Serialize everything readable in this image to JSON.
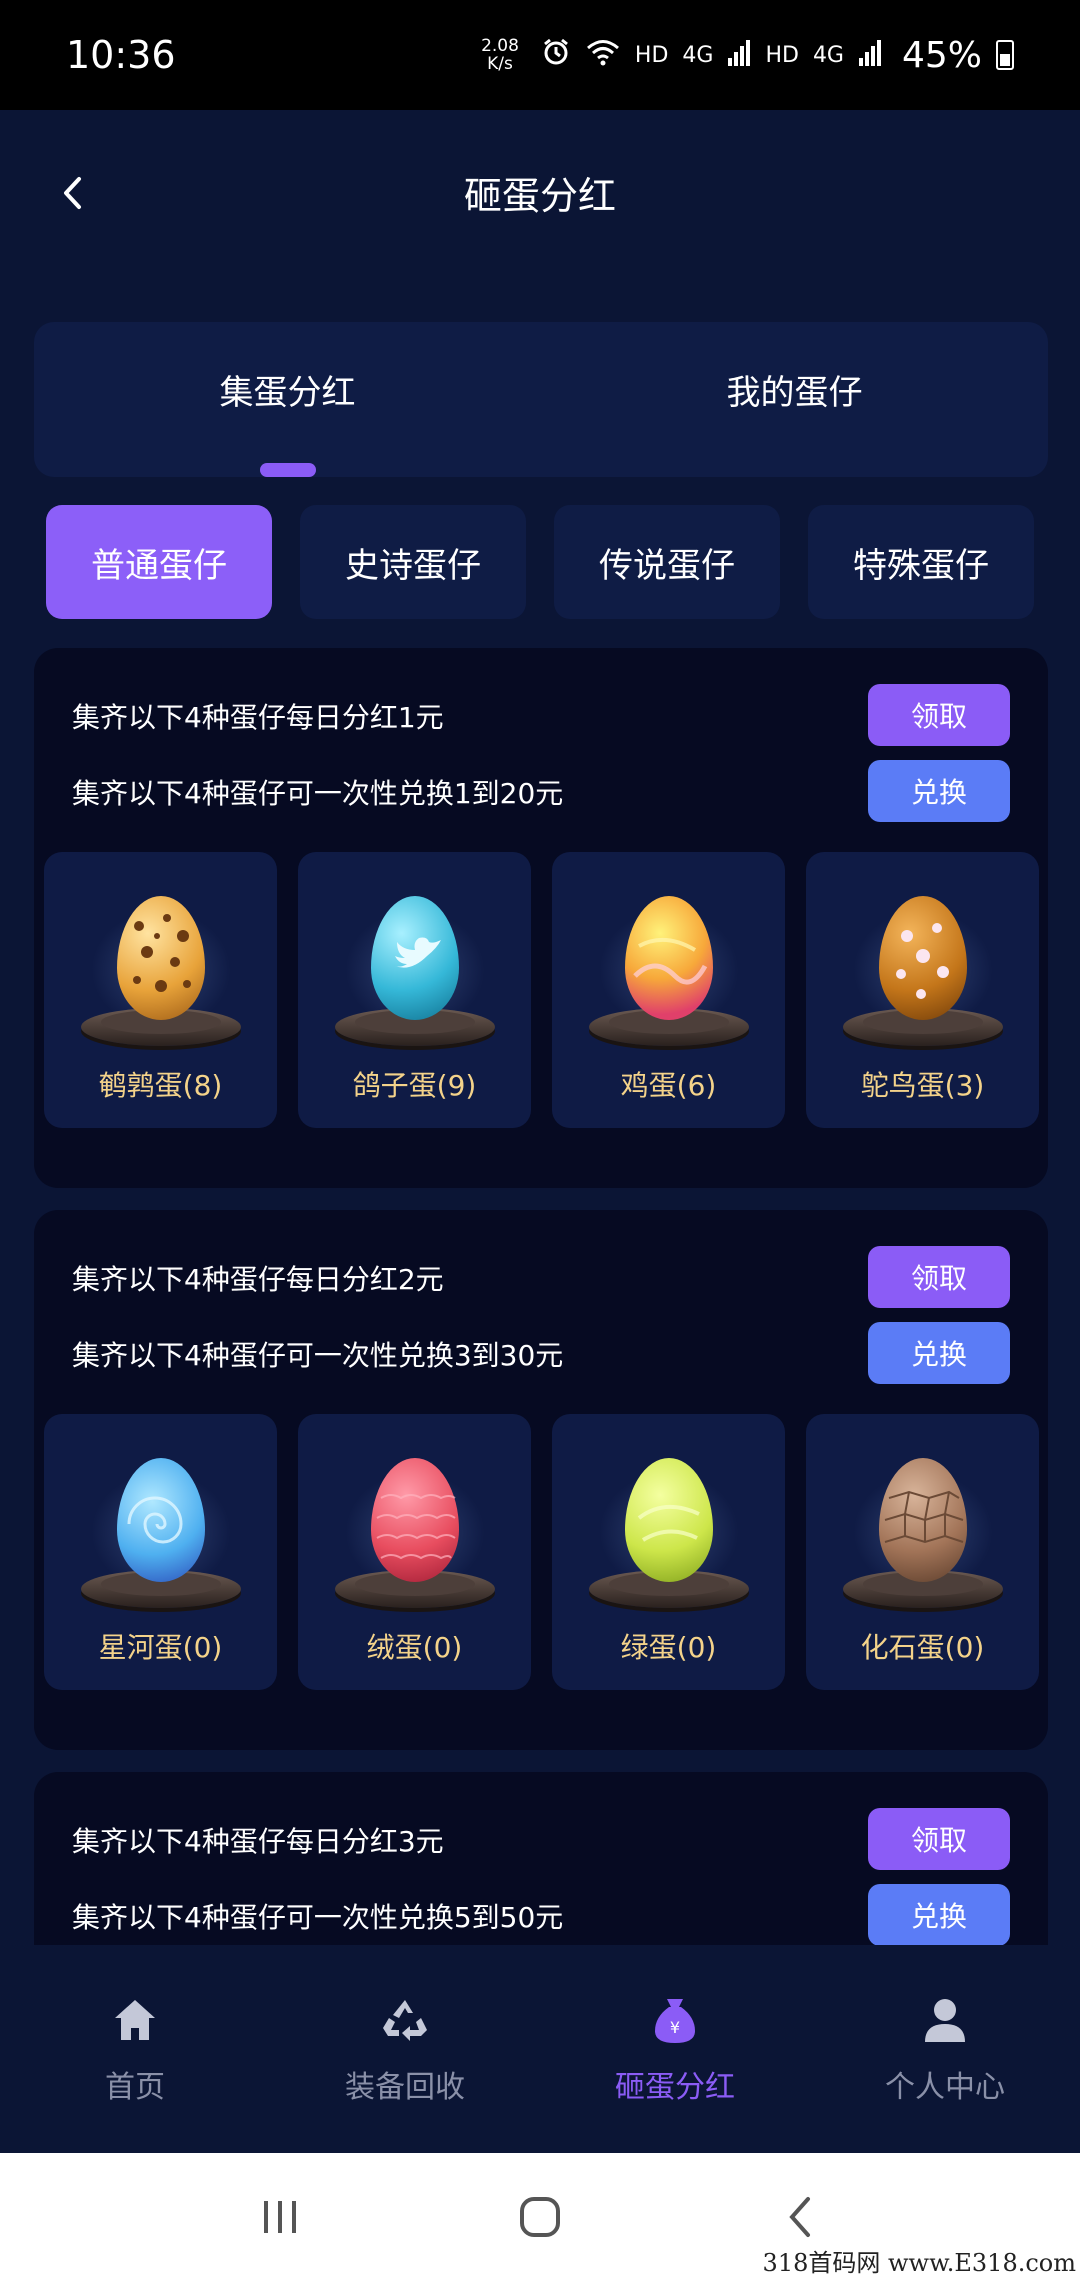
{
  "status": {
    "time": "10:36",
    "speed_value": "2.08",
    "speed_unit": "K/s",
    "network_1": "HD",
    "network_2": "4G",
    "network_3": "HD",
    "network_4": "4G",
    "battery": "45%"
  },
  "header": {
    "title": "砸蛋分红"
  },
  "main_tabs": [
    {
      "label": "集蛋分红",
      "active": true
    },
    {
      "label": "我的蛋仔",
      "active": false
    }
  ],
  "sub_tabs": [
    {
      "label": "普通蛋仔",
      "active": true
    },
    {
      "label": "史诗蛋仔",
      "active": false
    },
    {
      "label": "传说蛋仔",
      "active": false
    },
    {
      "label": "特殊蛋仔",
      "active": false
    }
  ],
  "groups": [
    {
      "daily_text": "集齐以下4种蛋仔每日分红1元",
      "exchange_text": "集齐以下4种蛋仔可一次性兑换1到20元",
      "claim_label": "领取",
      "exchange_label": "兑换",
      "eggs": [
        {
          "label": "鹌鹑蛋(8)",
          "color": "#e8a33a",
          "pattern": "spots"
        },
        {
          "label": "鸽子蛋(9)",
          "color": "#35b8d8",
          "pattern": "bird"
        },
        {
          "label": "鸡蛋(6)",
          "color": "#f7a83a",
          "pattern": "flame"
        },
        {
          "label": "鸵鸟蛋(3)",
          "color": "#c4761a",
          "pattern": "flowers"
        }
      ]
    },
    {
      "daily_text": "集齐以下4种蛋仔每日分红2元",
      "exchange_text": "集齐以下4种蛋仔可一次性兑换3到30元",
      "claim_label": "领取",
      "exchange_label": "兑换",
      "eggs": [
        {
          "label": "星河蛋(0)",
          "color": "#4fb0f0",
          "pattern": "swirl"
        },
        {
          "label": "绒蛋(0)",
          "color": "#e84d5f",
          "pattern": "fluff"
        },
        {
          "label": "绿蛋(0)",
          "color": "#cde64a",
          "pattern": "leaf"
        },
        {
          "label": "化石蛋(0)",
          "color": "#a27458",
          "pattern": "fossil"
        }
      ]
    },
    {
      "daily_text": "集齐以下4种蛋仔每日分红3元",
      "exchange_text": "集齐以下4种蛋仔可一次性兑换5到50元",
      "claim_label": "领取",
      "exchange_label": "兑换"
    }
  ],
  "bottom_nav": [
    {
      "label": "首页",
      "icon": "home-icon",
      "active": false
    },
    {
      "label": "装备回收",
      "icon": "recycle-icon",
      "active": false
    },
    {
      "label": "砸蛋分红",
      "icon": "money-bag-icon",
      "active": true
    },
    {
      "label": "个人中心",
      "icon": "user-icon",
      "active": false
    }
  ],
  "watermark": "318首码网  www.E318.com",
  "colors": {
    "accent": "#8b5cf6",
    "exchange": "#5b7cf6",
    "egg_label": "#f4d38a",
    "panel": "#0f1c45"
  }
}
